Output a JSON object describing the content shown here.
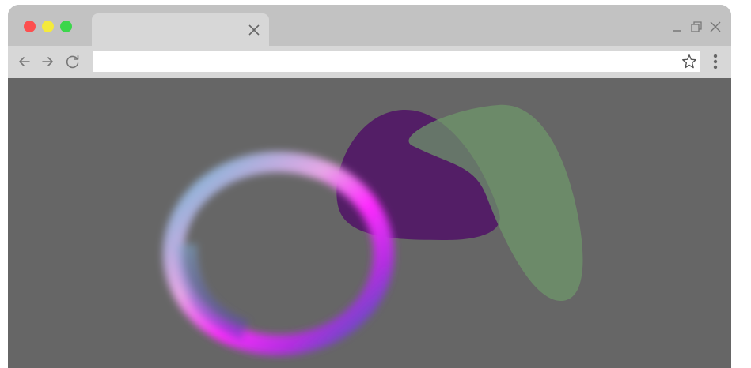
{
  "window": {
    "tab": {
      "title": ""
    },
    "controls": [
      "minimize",
      "restore",
      "close"
    ]
  },
  "toolbar": {
    "address": {
      "value": "",
      "placeholder": ""
    }
  },
  "colors": {
    "titlebar": "#c2c2c2",
    "tab": "#d7d7d7",
    "toolbar": "#d7d7d7",
    "content_bg": "#666666",
    "traffic_red": "#fd4f4f",
    "traffic_yellow": "#f4ea3c",
    "traffic_green": "#3bd64b",
    "purple_blob": "#531e66",
    "green_blob": "#5d755b"
  },
  "icons": {
    "back": "arrow-left-icon",
    "forward": "arrow-right-icon",
    "reload": "reload-icon",
    "star": "star-icon",
    "menu": "kebab-menu-icon",
    "tab_close": "close-icon"
  }
}
